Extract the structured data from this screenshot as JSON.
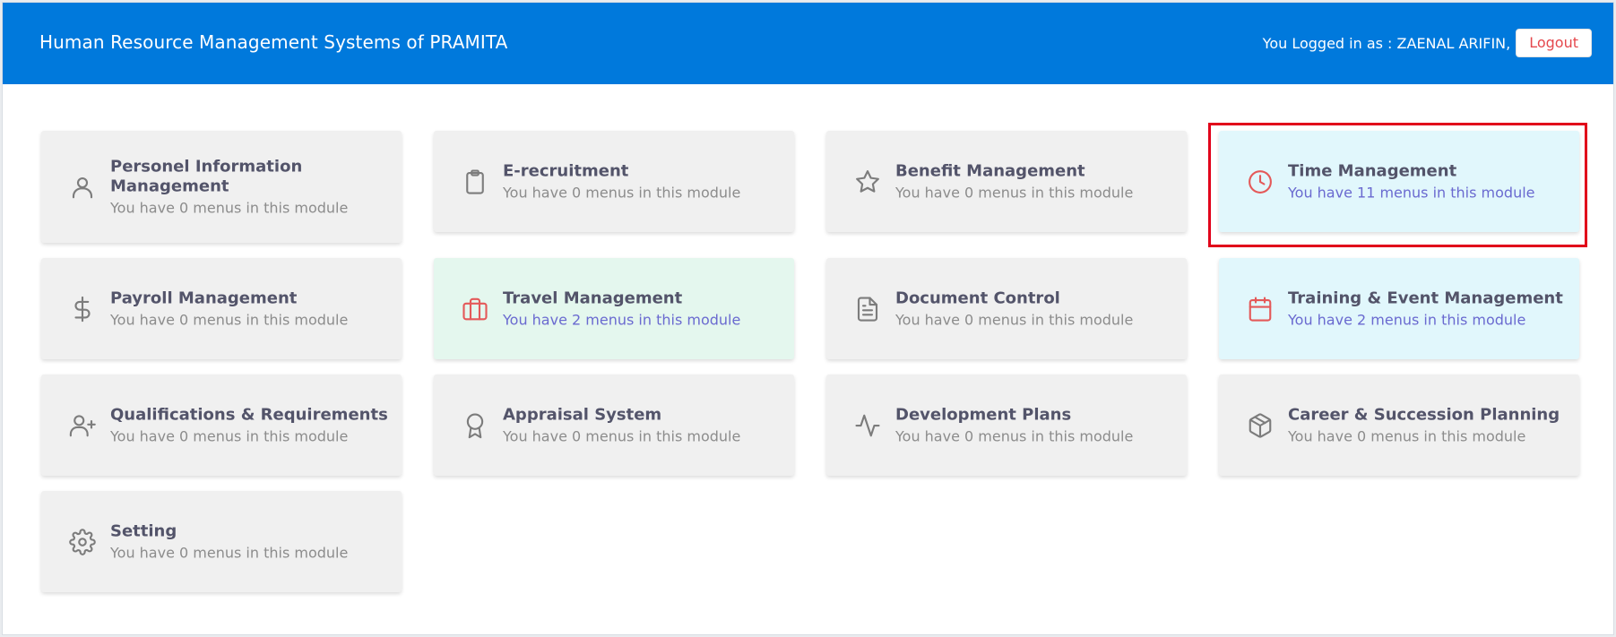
{
  "header": {
    "title": "Human Resource Management Systems of PRAMITA",
    "login_text": "You Logged in as : ZAENAL ARIFIN,",
    "logout_label": "Logout"
  },
  "colors": {
    "header_bg": "#0079dc",
    "card_default": "#f0f0f0",
    "card_green": "#e4f7ee",
    "card_cyan": "#e1f7fc",
    "highlight_border": "#e1001a"
  },
  "modules": [
    {
      "title": "Personel Information Management",
      "sub": "You have 0 menus in this module",
      "icon": "user-icon"
    },
    {
      "title": "E-recruitment",
      "sub": "You have 0 menus in this module",
      "icon": "clipboard-icon"
    },
    {
      "title": "Benefit Management",
      "sub": "You have 0 menus in this module",
      "icon": "star-icon"
    },
    {
      "title": "Time Management",
      "sub": "You have 11 menus in this module",
      "icon": "clock-icon"
    },
    {
      "title": "Payroll Management",
      "sub": "You have 0 menus in this module",
      "icon": "dollar-icon"
    },
    {
      "title": "Travel Management",
      "sub": "You have 2 menus in this module",
      "icon": "briefcase-icon"
    },
    {
      "title": "Document Control",
      "sub": "You have 0 menus in this module",
      "icon": "document-icon"
    },
    {
      "title": "Training & Event Management",
      "sub": "You have 2 menus in this module",
      "icon": "calendar-icon"
    },
    {
      "title": "Qualifications & Requirements",
      "sub": "You have 0 menus in this module",
      "icon": "user-plus-icon"
    },
    {
      "title": "Appraisal System",
      "sub": "You have 0 menus in this module",
      "icon": "award-icon"
    },
    {
      "title": "Development Plans",
      "sub": "You have 0 menus in this module",
      "icon": "activity-icon"
    },
    {
      "title": "Career & Succession Planning",
      "sub": "You have 0 menus in this module",
      "icon": "box-icon"
    },
    {
      "title": "Setting",
      "sub": "You have 0 menus in this module",
      "icon": "settings-icon"
    }
  ]
}
